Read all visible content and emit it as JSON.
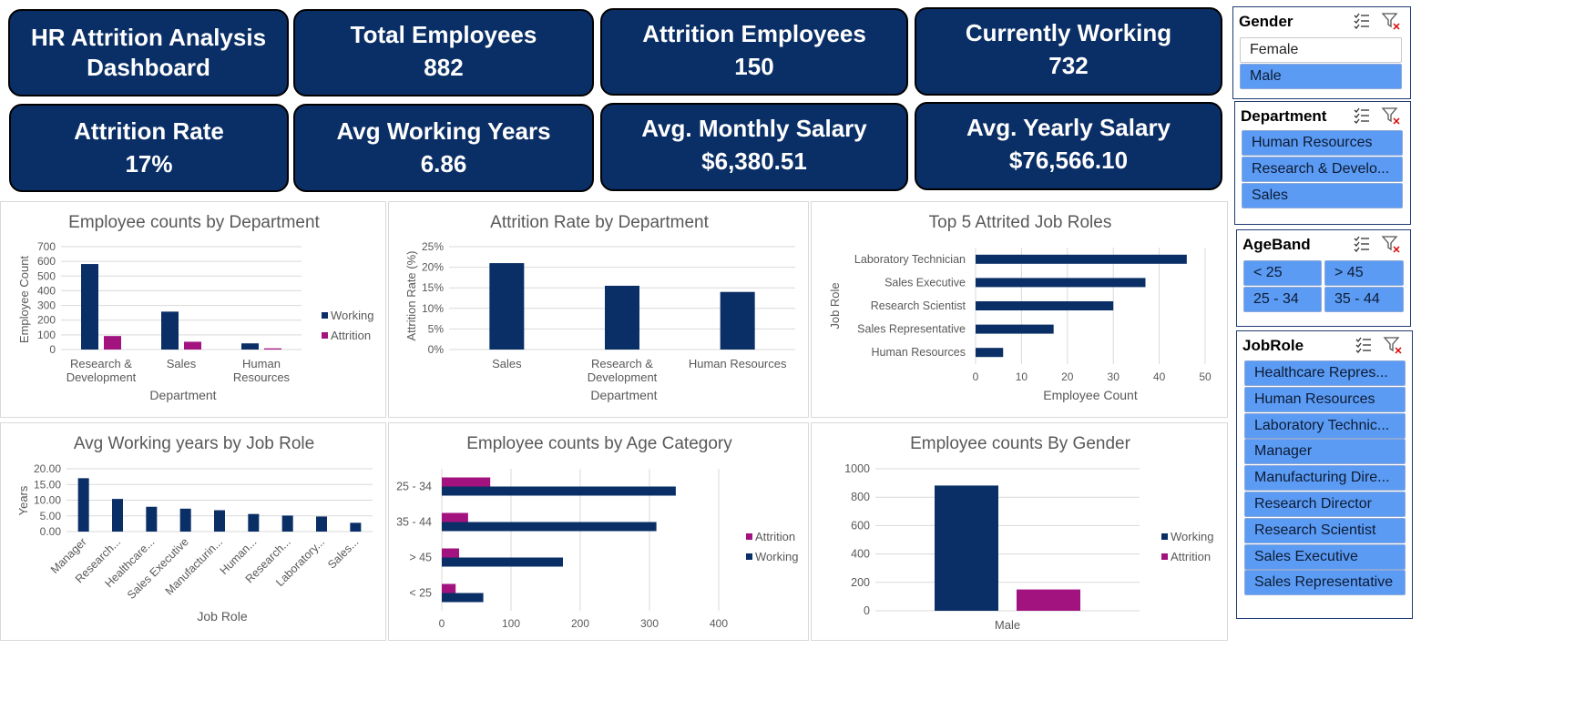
{
  "kpis": {
    "title": "HR Attrition Analysis Dashboard",
    "total_employees": {
      "label": "Total Employees",
      "value": "882"
    },
    "attrition_employees": {
      "label": "Attrition Employees",
      "value": "150"
    },
    "currently_working": {
      "label": "Currently Working",
      "value": "732"
    },
    "attrition_rate": {
      "label": "Attrition Rate",
      "value": "17%"
    },
    "avg_working_years": {
      "label": "Avg Working Years",
      "value": "6.86"
    },
    "avg_monthly_salary": {
      "label": "Avg. Monthly Salary",
      "value": "$6,380.51"
    },
    "avg_yearly_salary": {
      "label": "Avg. Yearly Salary",
      "value": "$76,566.10"
    }
  },
  "colors": {
    "navy": "#0a2f66",
    "magenta": "#a3137f",
    "kpi_bg": "#0a2f66",
    "slicer_selected": "#5b9bf4"
  },
  "slicers": {
    "gender": {
      "title": "Gender",
      "items": [
        {
          "label": "Female",
          "selected": false
        },
        {
          "label": "Male",
          "selected": true
        }
      ]
    },
    "department": {
      "title": "Department",
      "items": [
        {
          "label": "Human Resources",
          "selected": true
        },
        {
          "label": "Research & Develo...",
          "selected": true
        },
        {
          "label": "Sales",
          "selected": true
        }
      ]
    },
    "ageband": {
      "title": "AgeBand",
      "items": [
        {
          "label": "< 25",
          "selected": true
        },
        {
          "label": "> 45",
          "selected": true
        },
        {
          "label": "25 - 34",
          "selected": true
        },
        {
          "label": "35 - 44",
          "selected": true
        }
      ]
    },
    "jobrole": {
      "title": "JobRole",
      "items": [
        {
          "label": "Healthcare Repres...",
          "selected": true
        },
        {
          "label": "Human Resources",
          "selected": true
        },
        {
          "label": "Laboratory Technic...",
          "selected": true
        },
        {
          "label": "Manager",
          "selected": true
        },
        {
          "label": "Manufacturing Dire...",
          "selected": true
        },
        {
          "label": "Research Director",
          "selected": true
        },
        {
          "label": "Research Scientist",
          "selected": true
        },
        {
          "label": "Sales Executive",
          "selected": true
        },
        {
          "label": "Sales Representative",
          "selected": true
        }
      ]
    }
  },
  "chart_data": [
    {
      "id": "dept_counts",
      "type": "bar",
      "title": "Employee counts by Department",
      "xlabel": "Department",
      "ylabel": "Employee Count",
      "ylim": [
        0,
        700
      ],
      "yticks": [
        "0",
        "100",
        "200",
        "300",
        "400",
        "500",
        "600",
        "700"
      ],
      "categories": [
        [
          "Research &",
          "Development"
        ],
        [
          "Sales"
        ],
        [
          "Human",
          "Resources"
        ]
      ],
      "series": [
        {
          "name": "Working",
          "color": "#0a2f66",
          "values": [
            582,
            258,
            42
          ]
        },
        {
          "name": "Attrition",
          "color": "#a3137f",
          "values": [
            92,
            53,
            8
          ]
        }
      ],
      "legend": "right"
    },
    {
      "id": "dept_rate",
      "type": "bar",
      "title": "Attrition Rate by Department",
      "xlabel": "Department",
      "ylabel": "Attrition Rate (%)",
      "ylim": [
        0,
        25
      ],
      "yticks": [
        "0%",
        "5%",
        "10%",
        "15%",
        "20%",
        "25%"
      ],
      "categories": [
        [
          "Sales"
        ],
        [
          "Research &",
          "Development"
        ],
        [
          "Human Resources"
        ]
      ],
      "series": [
        {
          "color": "#0a2f66",
          "values": [
            21,
            15.5,
            14
          ]
        }
      ]
    },
    {
      "id": "top_roles",
      "type": "bar",
      "orientation": "horizontal",
      "title": "Top 5 Attrited Job Roles",
      "xlabel": "Employee Count",
      "ylabel": "Job Role",
      "xlim": [
        0,
        50
      ],
      "xticks": [
        "0",
        "10",
        "20",
        "30",
        "40",
        "50"
      ],
      "categories": [
        "Laboratory Technician",
        "Sales Executive",
        "Research Scientist",
        "Sales Representative",
        "Human Resources"
      ],
      "series": [
        {
          "color": "#0a2f66",
          "values": [
            46,
            37,
            30,
            17,
            6
          ]
        }
      ]
    },
    {
      "id": "avg_years",
      "type": "bar",
      "title": "Avg Working years by Job Role",
      "xlabel": "Job Role",
      "ylabel": "Years",
      "ylim": [
        0,
        20
      ],
      "yticks": [
        "0.00",
        "5.00",
        "10.00",
        "15.00",
        "20.00"
      ],
      "categories": [
        "Manager",
        "Research...",
        "Healthcare...",
        "Sales Executive",
        "Manufacturin...",
        "Human...",
        "Research...",
        "Laboratory...",
        "Sales..."
      ],
      "series": [
        {
          "color": "#0a2f66",
          "values": [
            17,
            10.4,
            7.9,
            7.3,
            6.8,
            5.6,
            5.1,
            4.8,
            2.8
          ]
        }
      ]
    },
    {
      "id": "age_counts",
      "type": "bar",
      "orientation": "horizontal",
      "title": "Employee counts by Age Category",
      "xlim": [
        0,
        400
      ],
      "xticks": [
        "0",
        "100",
        "200",
        "300",
        "400"
      ],
      "categories": [
        "25 - 34",
        "35 - 44",
        "> 45",
        "< 25"
      ],
      "series": [
        {
          "name": "Attrition",
          "color": "#a3137f",
          "values": [
            70,
            38,
            25,
            20
          ]
        },
        {
          "name": "Working",
          "color": "#0a2f66",
          "values": [
            338,
            310,
            175,
            60
          ]
        }
      ],
      "legend": "right"
    },
    {
      "id": "gender_counts",
      "type": "bar",
      "title": "Employee counts By Gender",
      "ylim": [
        0,
        1000
      ],
      "yticks": [
        "0",
        "200",
        "400",
        "600",
        "800",
        "1000"
      ],
      "categories": [
        "Male"
      ],
      "series": [
        {
          "name": "Working",
          "color": "#0a2f66",
          "values": [
            882
          ]
        },
        {
          "name": "Attrition",
          "color": "#a3137f",
          "values": [
            150
          ]
        }
      ],
      "legend": "right"
    }
  ]
}
